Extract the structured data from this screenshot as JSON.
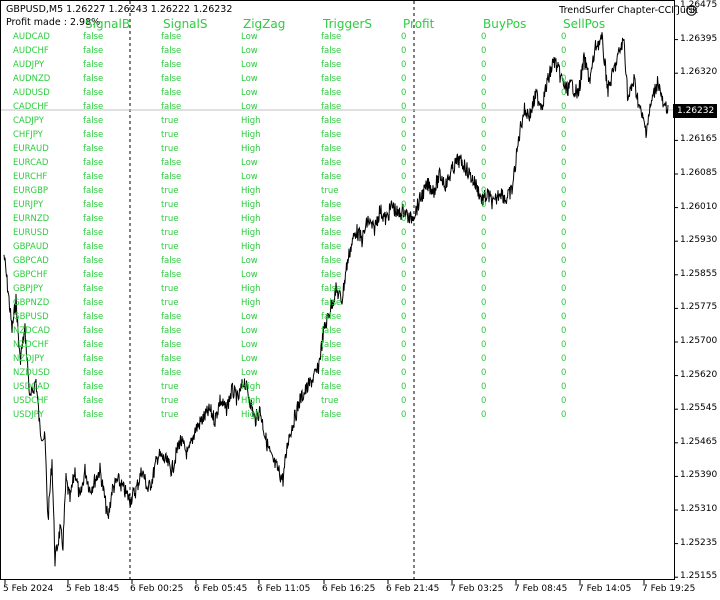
{
  "window": {
    "symbol_info": "GBPUSD,M5  1.26227 1.26243 1.26222 1.26232",
    "profit_made": "Profit made : 2.98%",
    "indicator_name": "TrendSurfer Chapter-CCI Jurik",
    "current_price": "1.26232"
  },
  "table": {
    "columns": [
      "SignalB",
      "SignalS",
      "ZigZag",
      "TriggerS",
      "Profit",
      "BuyPos",
      "SellPos"
    ],
    "rows": [
      {
        "symbol": "AUDCAD",
        "signal_b": "false",
        "signal_s": "false",
        "zigzag": "Low",
        "trigger_s": "false",
        "profit": "0",
        "buy_pos": "0",
        "sell_pos": "0"
      },
      {
        "symbol": "AUDCHF",
        "signal_b": "false",
        "signal_s": "false",
        "zigzag": "Low",
        "trigger_s": "false",
        "profit": "0",
        "buy_pos": "0",
        "sell_pos": "0"
      },
      {
        "symbol": "AUDJPY",
        "signal_b": "false",
        "signal_s": "false",
        "zigzag": "Low",
        "trigger_s": "false",
        "profit": "0",
        "buy_pos": "0",
        "sell_pos": "0"
      },
      {
        "symbol": "AUDNZD",
        "signal_b": "false",
        "signal_s": "false",
        "zigzag": "Low",
        "trigger_s": "false",
        "profit": "0",
        "buy_pos": "0",
        "sell_pos": "0"
      },
      {
        "symbol": "AUDUSD",
        "signal_b": "false",
        "signal_s": "false",
        "zigzag": "Low",
        "trigger_s": "false",
        "profit": "0",
        "buy_pos": "0",
        "sell_pos": "0"
      },
      {
        "symbol": "CADCHF",
        "signal_b": "false",
        "signal_s": "false",
        "zigzag": "Low",
        "trigger_s": "false",
        "profit": "0",
        "buy_pos": "0",
        "sell_pos": "0"
      },
      {
        "symbol": "CADJPY",
        "signal_b": "false",
        "signal_s": "true",
        "zigzag": "High",
        "trigger_s": "false",
        "profit": "0",
        "buy_pos": "0",
        "sell_pos": "0"
      },
      {
        "symbol": "CHFJPY",
        "signal_b": "false",
        "signal_s": "true",
        "zigzag": "High",
        "trigger_s": "false",
        "profit": "0",
        "buy_pos": "0",
        "sell_pos": "0"
      },
      {
        "symbol": "EURAUD",
        "signal_b": "false",
        "signal_s": "true",
        "zigzag": "High",
        "trigger_s": "false",
        "profit": "0",
        "buy_pos": "0",
        "sell_pos": "0"
      },
      {
        "symbol": "EURCAD",
        "signal_b": "false",
        "signal_s": "false",
        "zigzag": "Low",
        "trigger_s": "false",
        "profit": "0",
        "buy_pos": "0",
        "sell_pos": "0"
      },
      {
        "symbol": "EURCHF",
        "signal_b": "false",
        "signal_s": "false",
        "zigzag": "Low",
        "trigger_s": "false",
        "profit": "0",
        "buy_pos": "0",
        "sell_pos": "0"
      },
      {
        "symbol": "EURGBP",
        "signal_b": "false",
        "signal_s": "true",
        "zigzag": "High",
        "trigger_s": "true",
        "profit": "0",
        "buy_pos": "0",
        "sell_pos": "0"
      },
      {
        "symbol": "EURJPY",
        "signal_b": "false",
        "signal_s": "true",
        "zigzag": "High",
        "trigger_s": "false",
        "profit": "0",
        "buy_pos": "0",
        "sell_pos": "0"
      },
      {
        "symbol": "EURNZD",
        "signal_b": "false",
        "signal_s": "true",
        "zigzag": "High",
        "trigger_s": "false",
        "profit": "0",
        "buy_pos": "0",
        "sell_pos": "0"
      },
      {
        "symbol": "EURUSD",
        "signal_b": "false",
        "signal_s": "true",
        "zigzag": "High",
        "trigger_s": "false",
        "profit": "0",
        "buy_pos": "0",
        "sell_pos": "0"
      },
      {
        "symbol": "GBPAUD",
        "signal_b": "false",
        "signal_s": "true",
        "zigzag": "High",
        "trigger_s": "false",
        "profit": "0",
        "buy_pos": "0",
        "sell_pos": "0"
      },
      {
        "symbol": "GBPCAD",
        "signal_b": "false",
        "signal_s": "false",
        "zigzag": "Low",
        "trigger_s": "false",
        "profit": "0",
        "buy_pos": "0",
        "sell_pos": "0"
      },
      {
        "symbol": "GBPCHF",
        "signal_b": "false",
        "signal_s": "false",
        "zigzag": "Low",
        "trigger_s": "false",
        "profit": "0",
        "buy_pos": "0",
        "sell_pos": "0"
      },
      {
        "symbol": "GBPJPY",
        "signal_b": "false",
        "signal_s": "true",
        "zigzag": "High",
        "trigger_s": "false",
        "profit": "0",
        "buy_pos": "0",
        "sell_pos": "0"
      },
      {
        "symbol": "GBPNZD",
        "signal_b": "false",
        "signal_s": "true",
        "zigzag": "High",
        "trigger_s": "false",
        "profit": "0",
        "buy_pos": "0",
        "sell_pos": "0"
      },
      {
        "symbol": "GBPUSD",
        "signal_b": "false",
        "signal_s": "false",
        "zigzag": "Low",
        "trigger_s": "false",
        "profit": "0",
        "buy_pos": "0",
        "sell_pos": "0"
      },
      {
        "symbol": "NZDCAD",
        "signal_b": "false",
        "signal_s": "false",
        "zigzag": "Low",
        "trigger_s": "false",
        "profit": "0",
        "buy_pos": "0",
        "sell_pos": "0"
      },
      {
        "symbol": "NZDCHF",
        "signal_b": "false",
        "signal_s": "false",
        "zigzag": "Low",
        "trigger_s": "false",
        "profit": "0",
        "buy_pos": "0",
        "sell_pos": "0"
      },
      {
        "symbol": "NZDJPY",
        "signal_b": "false",
        "signal_s": "false",
        "zigzag": "Low",
        "trigger_s": "false",
        "profit": "0",
        "buy_pos": "0",
        "sell_pos": "0"
      },
      {
        "symbol": "NZDUSD",
        "signal_b": "false",
        "signal_s": "false",
        "zigzag": "Low",
        "trigger_s": "false",
        "profit": "0",
        "buy_pos": "0",
        "sell_pos": "0"
      },
      {
        "symbol": "USDCAD",
        "signal_b": "false",
        "signal_s": "true",
        "zigzag": "High",
        "trigger_s": "false",
        "profit": "0",
        "buy_pos": "0",
        "sell_pos": "0"
      },
      {
        "symbol": "USDCHF",
        "signal_b": "false",
        "signal_s": "true",
        "zigzag": "High",
        "trigger_s": "true",
        "profit": "0",
        "buy_pos": "0",
        "sell_pos": "0"
      },
      {
        "symbol": "USDJPY",
        "signal_b": "false",
        "signal_s": "true",
        "zigzag": "High",
        "trigger_s": "false",
        "profit": "0",
        "buy_pos": "0",
        "sell_pos": "0"
      }
    ]
  },
  "price_axis": [
    "1.26475",
    "1.26395",
    "1.26320",
    "1.26232",
    "1.26165",
    "1.26085",
    "1.26010",
    "1.25930",
    "1.25855",
    "1.25775",
    "1.25700",
    "1.25620",
    "1.25545",
    "1.25465",
    "1.25390",
    "1.25310",
    "1.25235",
    "1.25155"
  ],
  "time_axis": [
    "5 Feb 2024",
    "5 Feb 18:45",
    "6 Feb 00:25",
    "6 Feb 05:45",
    "6 Feb 11:05",
    "6 Feb 16:25",
    "6 Feb 21:45",
    "7 Feb 03:25",
    "7 Feb 08:45",
    "7 Feb 14:05",
    "7 Feb 19:25"
  ],
  "colors": {
    "table_text": "#2ecc40",
    "price_line": "#000000",
    "background": "#ffffff",
    "bid_line": "#c0c0c0"
  },
  "icons": {
    "indicator": "smiley-icon"
  }
}
